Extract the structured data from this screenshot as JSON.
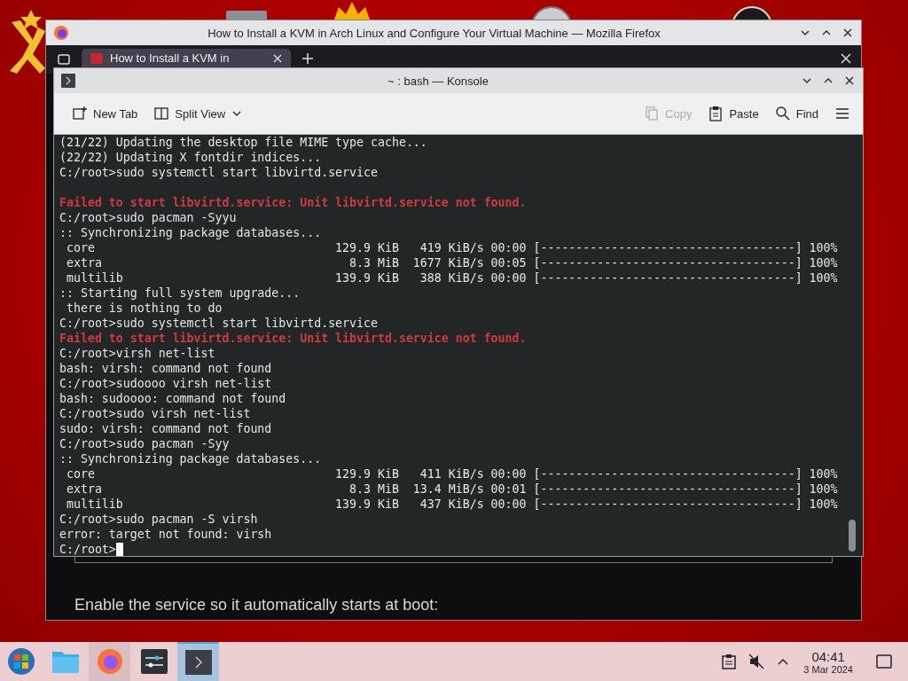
{
  "firefox_window": {
    "title": "How to Install a KVM in Arch Linux and Configure Your Virtual Machine — Mozilla Firefox",
    "tab": {
      "title": "How to Install a KVM in"
    },
    "page": {
      "paragraph": "Enable the service so it automatically starts at boot:"
    }
  },
  "konsole_window": {
    "title": "~ : bash — Konsole",
    "toolbar": [
      {
        "kind": "new-tab",
        "label": "New Tab",
        "disabled": false
      },
      {
        "kind": "split-view",
        "label": "Split View",
        "disabled": false
      },
      {
        "kind": "copy",
        "label": "Copy",
        "disabled": true
      },
      {
        "kind": "paste",
        "label": "Paste",
        "disabled": false
      },
      {
        "kind": "find",
        "label": "Find",
        "disabled": false
      }
    ],
    "terminal": {
      "lines": [
        {
          "kind": "output",
          "text": "(21/22) Updating the desktop file MIME type cache..."
        },
        {
          "kind": "output",
          "text": "(22/22) Updating X fontdir indices..."
        },
        {
          "kind": "output",
          "text": "C:/root>sudo systemctl start libvirtd.service"
        },
        {
          "kind": "blank"
        },
        {
          "kind": "error",
          "text": "Failed to start libvirtd.service: Unit libvirtd.service not found."
        },
        {
          "kind": "output",
          "text": "C:/root>sudo pacman -Syyu"
        },
        {
          "kind": "output",
          "text": ":: Synchronizing package databases..."
        },
        {
          "kind": "output",
          "text": " core                                  129.9 KiB   419 KiB/s 00:00 [------------------------------------] 100%"
        },
        {
          "kind": "output",
          "text": " extra                                   8.3 MiB  1677 KiB/s 00:05 [------------------------------------] 100%"
        },
        {
          "kind": "output",
          "text": " multilib                              139.9 KiB   388 KiB/s 00:00 [------------------------------------] 100%"
        },
        {
          "kind": "output",
          "text": ":: Starting full system upgrade..."
        },
        {
          "kind": "output",
          "text": " there is nothing to do"
        },
        {
          "kind": "output",
          "text": "C:/root>sudo systemctl start libvirtd.service"
        },
        {
          "kind": "error",
          "text": "Failed to start libvirtd.service: Unit libvirtd.service not found."
        },
        {
          "kind": "output",
          "text": "C:/root>virsh net-list"
        },
        {
          "kind": "output",
          "text": "bash: virsh: command not found"
        },
        {
          "kind": "output",
          "text": "C:/root>sudoooo virsh net-list"
        },
        {
          "kind": "output",
          "text": "bash: sudoooo: command not found"
        },
        {
          "kind": "output",
          "text": "C:/root>sudo virsh net-list"
        },
        {
          "kind": "output",
          "text": "sudo: virsh: command not found"
        },
        {
          "kind": "output",
          "text": "C:/root>sudo pacman -Syy"
        },
        {
          "kind": "output",
          "text": ":: Synchronizing package databases..."
        },
        {
          "kind": "output",
          "text": " core                                  129.9 KiB   411 KiB/s 00:00 [------------------------------------] 100%"
        },
        {
          "kind": "output",
          "text": " extra                                   8.3 MiB  13.4 MiB/s 00:01 [------------------------------------] 100%"
        },
        {
          "kind": "output",
          "text": " multilib                              139.9 KiB   437 KiB/s 00:00 [------------------------------------] 100%"
        },
        {
          "kind": "output",
          "text": "C:/root>sudo pacman -S virsh"
        },
        {
          "kind": "output",
          "text": "error: target not found: virsh"
        },
        {
          "kind": "cursor",
          "text": "C:/root>"
        }
      ]
    }
  },
  "taskbar": {
    "apps": [
      {
        "kind": "start",
        "open": false,
        "selected": false
      },
      {
        "kind": "files",
        "open": false,
        "selected": false
      },
      {
        "kind": "firefox",
        "open": true,
        "selected": false
      },
      {
        "kind": "settings",
        "open": false,
        "selected": false
      },
      {
        "kind": "terminal",
        "open": true,
        "selected": true
      }
    ],
    "clock": {
      "time": "04:41",
      "date": "3 Mar 2024"
    }
  }
}
